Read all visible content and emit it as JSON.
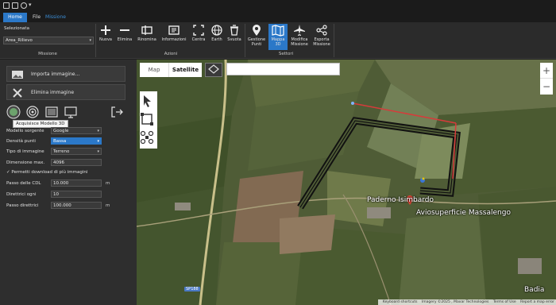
{
  "colors": {
    "accent": "#2b78c8",
    "route": "#111111",
    "route_inner": "#d63b3b",
    "panel": "#2e2e2e"
  },
  "titlebar": {
    "icons": [
      "save-icon",
      "folder-icon",
      "settings-icon"
    ],
    "caret": "▾"
  },
  "tabs": [
    {
      "label": "Home",
      "active": true
    },
    {
      "label": "File",
      "active": false
    },
    {
      "label": "Missione",
      "active": false
    }
  ],
  "selection": {
    "label": "Selezionata",
    "value": "Area_Rilievo"
  },
  "ribbon_groups": {
    "missione": "Missione",
    "azioni": "Azioni",
    "settori": "Settori"
  },
  "ribbon_buttons": [
    {
      "label": "Nuova",
      "icon": "plus-icon"
    },
    {
      "label": "Elimina",
      "icon": "minus-icon"
    },
    {
      "label": "Rinomina",
      "icon": "rename-icon"
    },
    {
      "label": "Informazioni",
      "icon": "info-icon"
    },
    {
      "label": "Centra",
      "icon": "center-icon"
    },
    {
      "label": "Earth",
      "icon": "globe-icon"
    },
    {
      "label": "Svuota",
      "icon": "trash-icon"
    },
    {
      "label": "Gestione Punti",
      "icon": "pin-icon"
    },
    {
      "label": "Mappa 3D",
      "icon": "map-icon",
      "active": true
    },
    {
      "label": "Modifica Missione",
      "icon": "plane-icon"
    },
    {
      "label": "Esporta Missione",
      "icon": "export-icon"
    }
  ],
  "left_panel": {
    "import_label": "Importa immagine...",
    "delete_label": "Elimina immagine",
    "tooltip": "Acquisisce Modello 3D",
    "fields": {
      "modello_sorgente": {
        "label": "Modello sorgente",
        "value": "Google"
      },
      "densita_punti": {
        "label": "Densità punti",
        "value": "Bassa"
      },
      "tipo_immagine": {
        "label": "Tipo di immagine",
        "value": "Terreno"
      },
      "dimensione_max": {
        "label": "Dimensione max.",
        "value": "4096"
      },
      "permetti": {
        "label": "Permetti download di più immagini",
        "checked": true
      },
      "passo_cdl": {
        "label": "Passo delle CDL",
        "value": "10.000",
        "unit": "m"
      },
      "direttrici": {
        "label": "Direttrici ogni",
        "value": "10"
      },
      "passo_direttrici": {
        "label": "Passo direttrici",
        "value": "100.000",
        "unit": "m"
      }
    }
  },
  "map": {
    "type_map": "Map",
    "type_satellite": "Satellite",
    "zoom_in": "+",
    "zoom_out": "−",
    "place_labels": {
      "paderno": "Paderno Isimbardo",
      "aviosuperficie": "Aviosuperficie Massalengo",
      "badia": "Badia"
    },
    "road_badge": "SP188",
    "footer": {
      "shortcuts": "Keyboard shortcuts",
      "imagery": "Imagery ©2025 , Maxar Technologies",
      "terms": "Terms of Use",
      "report": "Report a map error"
    }
  }
}
